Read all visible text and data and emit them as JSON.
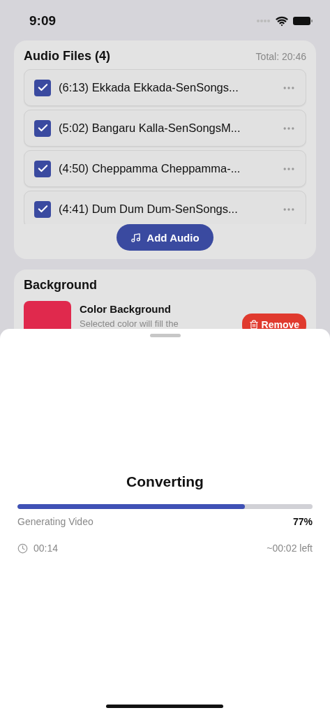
{
  "status_bar": {
    "time": "9:09"
  },
  "audio_files": {
    "title": "Audio Files (4)",
    "total": "Total: 20:46",
    "items": [
      {
        "label": "(6:13) Ekkada Ekkada-SenSongs...",
        "checked": true
      },
      {
        "label": "(5:02) Bangaru Kalla-SenSongsM...",
        "checked": true
      },
      {
        "label": "(4:50) Cheppamma Cheppamma-...",
        "checked": true
      },
      {
        "label": "(4:41) Dum Dum Dum-SenSongs...",
        "checked": true
      }
    ],
    "add_button": "Add Audio"
  },
  "background": {
    "title": "Background",
    "item_title": "Color Background",
    "description": "Selected color will fill the",
    "color": "#e0294d",
    "remove_button": "Remove"
  },
  "sheet": {
    "title": "Converting",
    "level": 0.77,
    "stage": "Generating Video",
    "percent": "77%",
    "elapsed": "00:14",
    "remaining": "~00:02 left"
  }
}
